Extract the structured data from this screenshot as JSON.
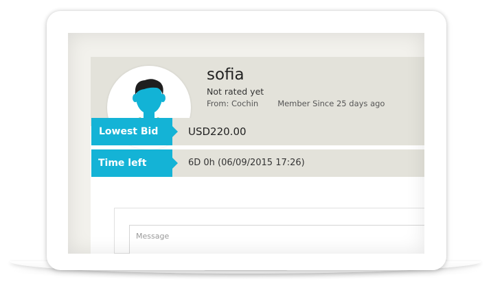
{
  "profile": {
    "username": "sofia",
    "rating": "Not rated yet",
    "from": "From: Cochin",
    "member_since": "Member Since 25 days ago",
    "avatar_icon": "user-avatar-icon"
  },
  "bid": {
    "label": "Lowest Bid",
    "value": "USD220.00"
  },
  "time": {
    "label": "Time left",
    "value": "6D 0h (06/09/2015 17:26)"
  },
  "message": {
    "placeholder": "Message"
  },
  "colors": {
    "accent": "#14b3d6",
    "panel": "#e3e2da",
    "avatar_skin": "#12b3d6",
    "avatar_shirt": "#7cb342"
  }
}
